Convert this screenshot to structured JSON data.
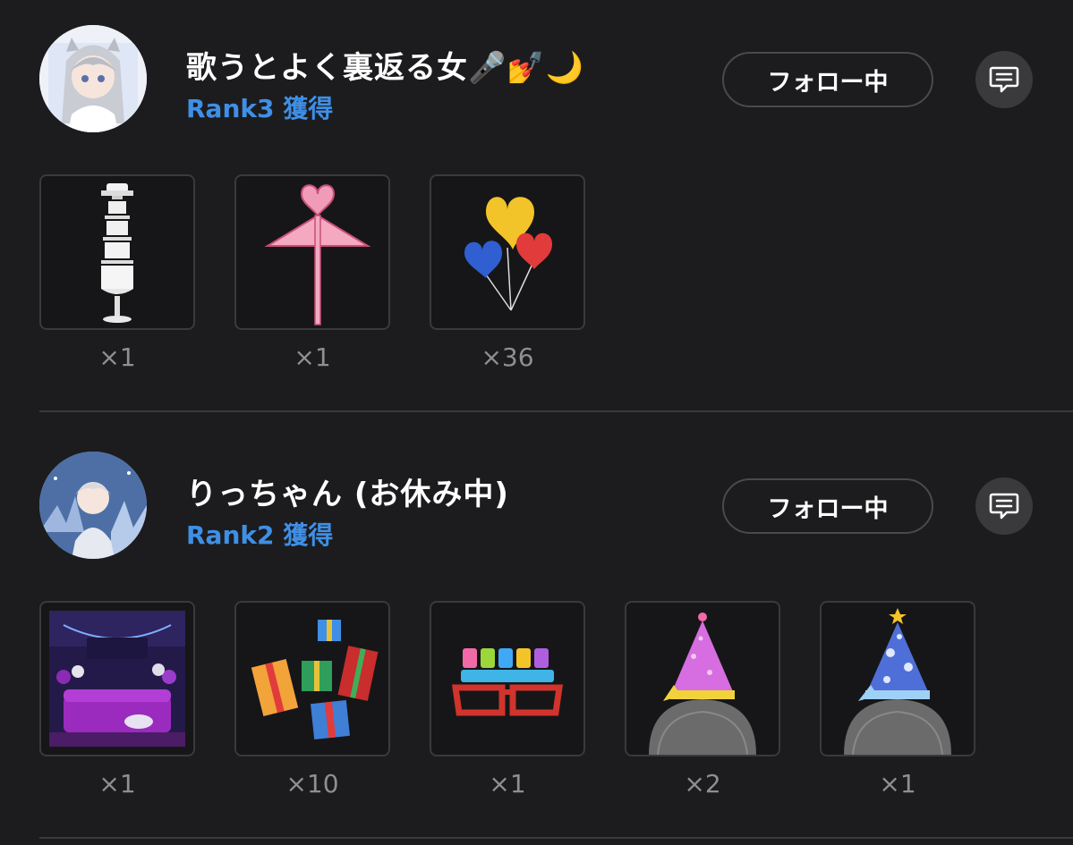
{
  "entries": [
    {
      "name": "歌うとよく裏返る女🎤💅🌙",
      "rank": "Rank3 獲得",
      "follow_label": "フォロー中",
      "items": [
        {
          "icon": "wedding-cake-tower-icon",
          "count": "×1"
        },
        {
          "icon": "heart-flag-icon",
          "count": "×1"
        },
        {
          "icon": "heart-balloons-icon",
          "count": "×36"
        }
      ]
    },
    {
      "name": "りっちゃん (お休み中)",
      "rank": "Rank2 獲得",
      "follow_label": "フォロー中",
      "items": [
        {
          "icon": "birthday-room-icon",
          "count": "×1"
        },
        {
          "icon": "gift-boxes-icon",
          "count": "×10"
        },
        {
          "icon": "happy-birthday-glasses-icon",
          "count": "×1"
        },
        {
          "icon": "pink-party-hat-icon",
          "count": "×2"
        },
        {
          "icon": "blue-party-hat-icon",
          "count": "×1"
        }
      ]
    }
  ],
  "colors": {
    "background": "#1c1c1e",
    "rank_text": "#3f8fe6",
    "count_text": "#8e8e93",
    "border": "#3a3a3d"
  }
}
